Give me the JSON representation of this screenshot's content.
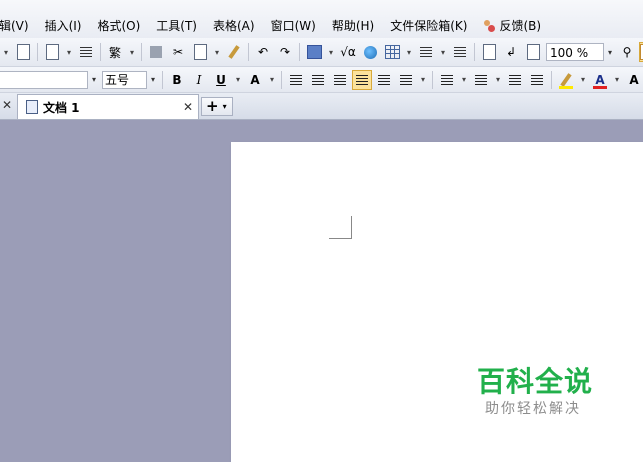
{
  "menubar": {
    "items": [
      "编辑(V)",
      "插入(I)",
      "格式(O)",
      "工具(T)",
      "表格(A)",
      "窗口(W)",
      "帮助(H)",
      "文件保险箱(K)"
    ],
    "feedback": "反馈(B)"
  },
  "toolbar": {
    "traditional": "繁",
    "sqrt_label": "√α",
    "zoom_value": "100 %"
  },
  "format_bar": {
    "font_size": "五号",
    "bold": "B",
    "italic": "I",
    "underline": "U",
    "font_effect": "A",
    "font_color": "A",
    "grow_font": "A",
    "highlight_color": "#ffe900",
    "font_color_value": "#e02020"
  },
  "tabs": {
    "document_tab": "文档 1",
    "new_tab": "+"
  },
  "watermark": {
    "title": "百科全说",
    "subtitle": "助你轻松解决"
  },
  "colors": {
    "workspace": "#9b9db7",
    "brand_green": "#21b04b",
    "active_button": "#fbe29b"
  }
}
